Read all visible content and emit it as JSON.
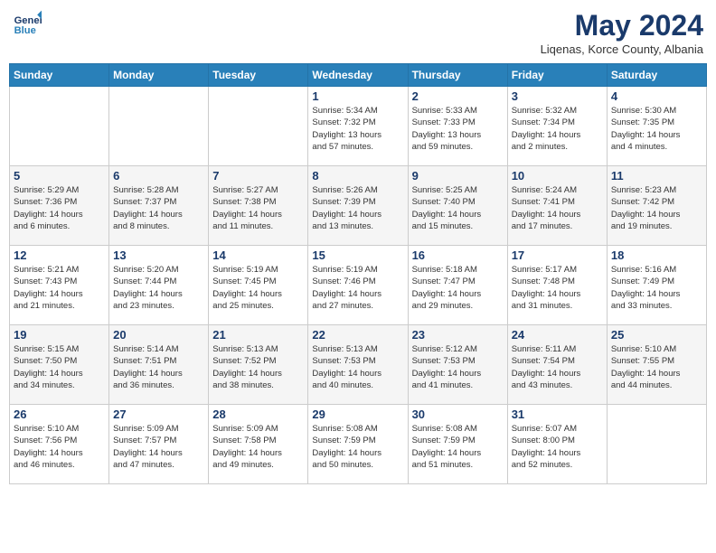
{
  "header": {
    "logo_line1": "General",
    "logo_line2": "Blue",
    "month_title": "May 2024",
    "subtitle": "Liqenas, Korce County, Albania"
  },
  "days_of_week": [
    "Sunday",
    "Monday",
    "Tuesday",
    "Wednesday",
    "Thursday",
    "Friday",
    "Saturday"
  ],
  "weeks": [
    [
      {
        "num": "",
        "info": ""
      },
      {
        "num": "",
        "info": ""
      },
      {
        "num": "",
        "info": ""
      },
      {
        "num": "1",
        "info": "Sunrise: 5:34 AM\nSunset: 7:32 PM\nDaylight: 13 hours\nand 57 minutes."
      },
      {
        "num": "2",
        "info": "Sunrise: 5:33 AM\nSunset: 7:33 PM\nDaylight: 13 hours\nand 59 minutes."
      },
      {
        "num": "3",
        "info": "Sunrise: 5:32 AM\nSunset: 7:34 PM\nDaylight: 14 hours\nand 2 minutes."
      },
      {
        "num": "4",
        "info": "Sunrise: 5:30 AM\nSunset: 7:35 PM\nDaylight: 14 hours\nand 4 minutes."
      }
    ],
    [
      {
        "num": "5",
        "info": "Sunrise: 5:29 AM\nSunset: 7:36 PM\nDaylight: 14 hours\nand 6 minutes."
      },
      {
        "num": "6",
        "info": "Sunrise: 5:28 AM\nSunset: 7:37 PM\nDaylight: 14 hours\nand 8 minutes."
      },
      {
        "num": "7",
        "info": "Sunrise: 5:27 AM\nSunset: 7:38 PM\nDaylight: 14 hours\nand 11 minutes."
      },
      {
        "num": "8",
        "info": "Sunrise: 5:26 AM\nSunset: 7:39 PM\nDaylight: 14 hours\nand 13 minutes."
      },
      {
        "num": "9",
        "info": "Sunrise: 5:25 AM\nSunset: 7:40 PM\nDaylight: 14 hours\nand 15 minutes."
      },
      {
        "num": "10",
        "info": "Sunrise: 5:24 AM\nSunset: 7:41 PM\nDaylight: 14 hours\nand 17 minutes."
      },
      {
        "num": "11",
        "info": "Sunrise: 5:23 AM\nSunset: 7:42 PM\nDaylight: 14 hours\nand 19 minutes."
      }
    ],
    [
      {
        "num": "12",
        "info": "Sunrise: 5:21 AM\nSunset: 7:43 PM\nDaylight: 14 hours\nand 21 minutes."
      },
      {
        "num": "13",
        "info": "Sunrise: 5:20 AM\nSunset: 7:44 PM\nDaylight: 14 hours\nand 23 minutes."
      },
      {
        "num": "14",
        "info": "Sunrise: 5:19 AM\nSunset: 7:45 PM\nDaylight: 14 hours\nand 25 minutes."
      },
      {
        "num": "15",
        "info": "Sunrise: 5:19 AM\nSunset: 7:46 PM\nDaylight: 14 hours\nand 27 minutes."
      },
      {
        "num": "16",
        "info": "Sunrise: 5:18 AM\nSunset: 7:47 PM\nDaylight: 14 hours\nand 29 minutes."
      },
      {
        "num": "17",
        "info": "Sunrise: 5:17 AM\nSunset: 7:48 PM\nDaylight: 14 hours\nand 31 minutes."
      },
      {
        "num": "18",
        "info": "Sunrise: 5:16 AM\nSunset: 7:49 PM\nDaylight: 14 hours\nand 33 minutes."
      }
    ],
    [
      {
        "num": "19",
        "info": "Sunrise: 5:15 AM\nSunset: 7:50 PM\nDaylight: 14 hours\nand 34 minutes."
      },
      {
        "num": "20",
        "info": "Sunrise: 5:14 AM\nSunset: 7:51 PM\nDaylight: 14 hours\nand 36 minutes."
      },
      {
        "num": "21",
        "info": "Sunrise: 5:13 AM\nSunset: 7:52 PM\nDaylight: 14 hours\nand 38 minutes."
      },
      {
        "num": "22",
        "info": "Sunrise: 5:13 AM\nSunset: 7:53 PM\nDaylight: 14 hours\nand 40 minutes."
      },
      {
        "num": "23",
        "info": "Sunrise: 5:12 AM\nSunset: 7:53 PM\nDaylight: 14 hours\nand 41 minutes."
      },
      {
        "num": "24",
        "info": "Sunrise: 5:11 AM\nSunset: 7:54 PM\nDaylight: 14 hours\nand 43 minutes."
      },
      {
        "num": "25",
        "info": "Sunrise: 5:10 AM\nSunset: 7:55 PM\nDaylight: 14 hours\nand 44 minutes."
      }
    ],
    [
      {
        "num": "26",
        "info": "Sunrise: 5:10 AM\nSunset: 7:56 PM\nDaylight: 14 hours\nand 46 minutes."
      },
      {
        "num": "27",
        "info": "Sunrise: 5:09 AM\nSunset: 7:57 PM\nDaylight: 14 hours\nand 47 minutes."
      },
      {
        "num": "28",
        "info": "Sunrise: 5:09 AM\nSunset: 7:58 PM\nDaylight: 14 hours\nand 49 minutes."
      },
      {
        "num": "29",
        "info": "Sunrise: 5:08 AM\nSunset: 7:59 PM\nDaylight: 14 hours\nand 50 minutes."
      },
      {
        "num": "30",
        "info": "Sunrise: 5:08 AM\nSunset: 7:59 PM\nDaylight: 14 hours\nand 51 minutes."
      },
      {
        "num": "31",
        "info": "Sunrise: 5:07 AM\nSunset: 8:00 PM\nDaylight: 14 hours\nand 52 minutes."
      },
      {
        "num": "",
        "info": ""
      }
    ]
  ]
}
